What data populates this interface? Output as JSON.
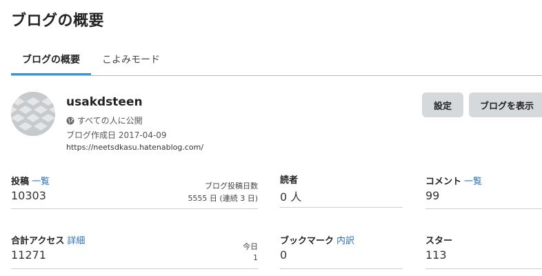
{
  "page": {
    "title": "ブログの概要"
  },
  "tabs": [
    {
      "label": "ブログの概要"
    },
    {
      "label": "こよみモード"
    }
  ],
  "profile": {
    "name": "usakdsteen",
    "visibility": "すべての人に公開",
    "created": "ブログ作成日 2017-04-09",
    "url": "https://neetsdkasu.hatenablog.com/"
  },
  "buttons": {
    "settings": "設定",
    "view_blog": "ブログを表示"
  },
  "stats": {
    "posts": {
      "label": "投稿",
      "link": "一覧",
      "value": "10303",
      "side_label": "ブログ投稿日数",
      "side_value": "5555 日 (連続 3 日)"
    },
    "readers": {
      "label": "読者",
      "value": "0 人"
    },
    "comments": {
      "label": "コメント",
      "link": "一覧",
      "value": "99"
    },
    "access": {
      "label": "合計アクセス",
      "link": "詳細",
      "value": "11271",
      "side_label": "今日",
      "side_value": "1"
    },
    "bookmarks": {
      "label": "ブックマーク",
      "link": "内訳",
      "value": "0"
    },
    "stars": {
      "label": "スター",
      "value": "113"
    }
  }
}
